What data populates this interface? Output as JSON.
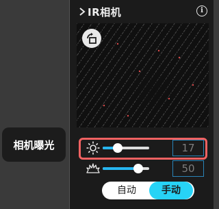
{
  "panel": {
    "title": "IR相机",
    "chevron_icon": "chevron-right-icon",
    "info_icon": "info-icon",
    "info_glyph": "i"
  },
  "preview": {
    "rotate_icon": "rotate-icon"
  },
  "exposure": {
    "brightness_icon": "sun-icon",
    "brightness_value": "17",
    "brightness_level": 0.33,
    "gain_icon": "burst-icon",
    "gain_value": "50",
    "gain_level": 0.76
  },
  "mode": {
    "auto_label": "自动",
    "manual_label": "手动",
    "selected": "手动"
  },
  "tooltip": {
    "text": "相机曝光"
  },
  "colors": {
    "accent": "#27b6f0",
    "toggle_active": "#27d3f6",
    "highlight": "#f26262"
  }
}
